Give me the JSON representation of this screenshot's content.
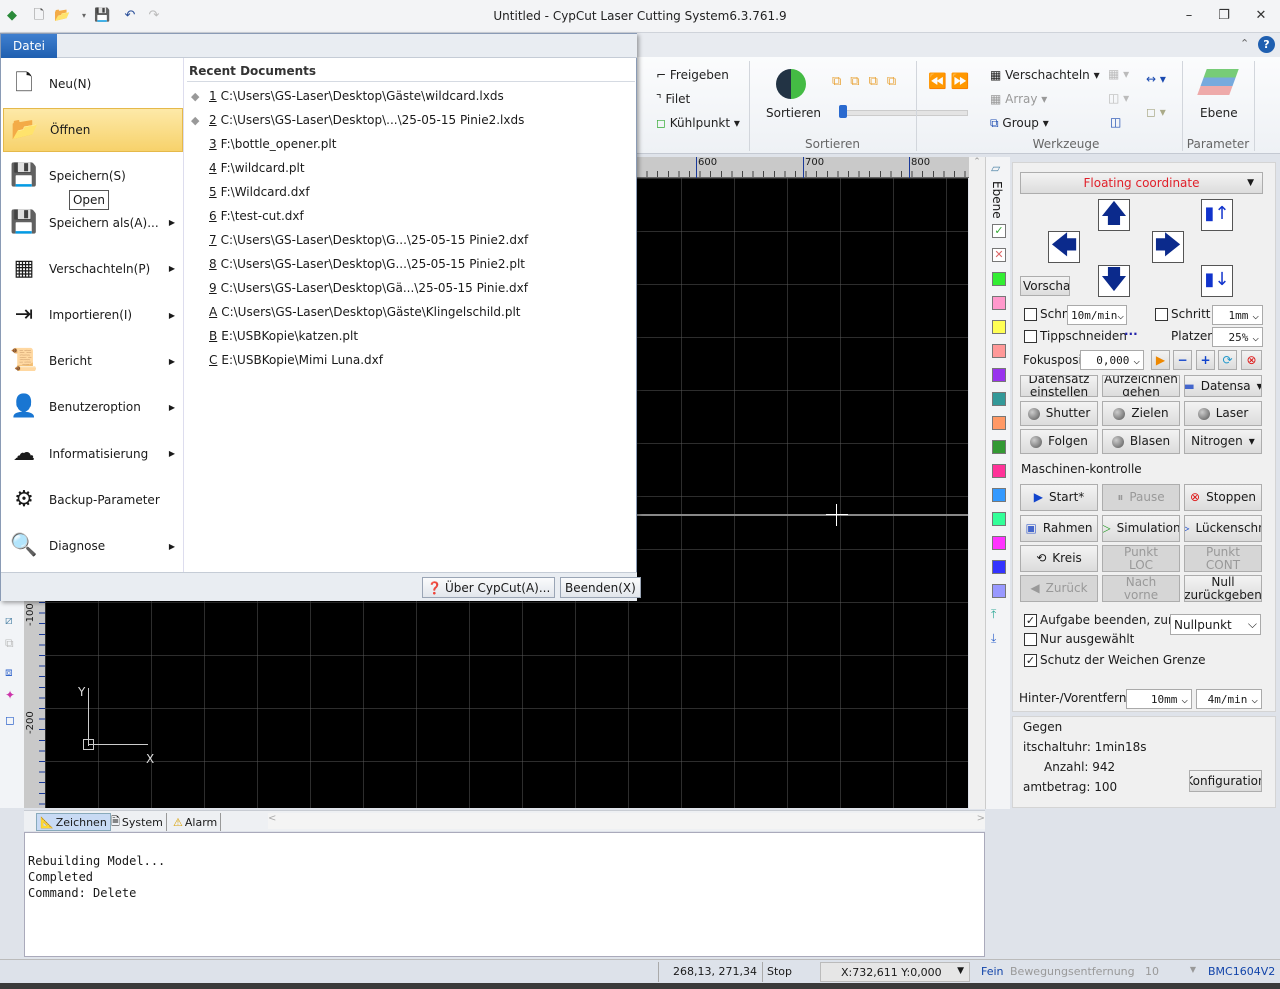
{
  "window": {
    "title": "Untitled - CypCut Laser Cutting System6.3.761.9"
  },
  "quick_access": {
    "icons": [
      "app-logo-icon",
      "new-file-icon",
      "open-folder-icon",
      "dropdown-icon",
      "save-icon",
      "undo-icon",
      "redo-icon"
    ]
  },
  "file_menu": {
    "tab_label": "Datei",
    "items": [
      {
        "label": "Neu(N)",
        "icon": "new-file-icon",
        "submenu": false
      },
      {
        "label": "Öffnen",
        "icon": "open-folder-icon",
        "submenu": false,
        "highlighted": true
      },
      {
        "label": "Speichern(S)",
        "icon": "save-icon",
        "submenu": false
      },
      {
        "label": "Speichern als(A)...",
        "icon": "save-as-icon",
        "submenu": true
      },
      {
        "label": "Verschachteln(P)",
        "icon": "nesting-icon",
        "submenu": true
      },
      {
        "label": "Importieren(I)",
        "icon": "import-icon",
        "submenu": true
      },
      {
        "label": "Bericht",
        "icon": "report-icon",
        "submenu": true
      },
      {
        "label": "Benutzeroption",
        "icon": "user-option-icon",
        "submenu": true
      },
      {
        "label": "Informatisierung",
        "icon": "cloud-icon",
        "submenu": true
      },
      {
        "label": "Backup-Parameter",
        "icon": "backup-icon",
        "submenu": false
      },
      {
        "label": "Diagnose",
        "icon": "diagnose-icon",
        "submenu": true
      }
    ],
    "tooltip": "Open",
    "recent_title": "Recent Documents",
    "recent": [
      {
        "key": "1",
        "path": "C:\\Users\\GS-Laser\\Desktop\\Gäste\\wildcard.lxds",
        "pinned": true
      },
      {
        "key": "2",
        "path": "C:\\Users\\GS-Laser\\Desktop\\...\\25-05-15 Pinie2.lxds",
        "pinned": true
      },
      {
        "key": "3",
        "path": "F:\\bottle_opener.plt"
      },
      {
        "key": "4",
        "path": "F:\\wildcard.plt"
      },
      {
        "key": "5",
        "path": "F:\\Wildcard.dxf"
      },
      {
        "key": "6",
        "path": "F:\\test-cut.dxf"
      },
      {
        "key": "7",
        "path": "C:\\Users\\GS-Laser\\Desktop\\G...\\25-05-15 Pinie2.dxf"
      },
      {
        "key": "8",
        "path": "C:\\Users\\GS-Laser\\Desktop\\G...\\25-05-15 Pinie2.plt"
      },
      {
        "key": "9",
        "path": "C:\\Users\\GS-Laser\\Desktop\\Gä...\\25-05-15 Pinie.dxf"
      },
      {
        "key": "A",
        "path": "C:\\Users\\GS-Laser\\Desktop\\Gäste\\Klingelschild.plt"
      },
      {
        "key": "B",
        "path": "E:\\USBKopie\\katzen.plt"
      },
      {
        "key": "C",
        "path": "E:\\USBKopie\\Mimi Luna.dxf"
      }
    ],
    "about_label": "Über CypCut(A)...",
    "exit_label": "Beenden(X)"
  },
  "ribbon": {
    "freigeben": "Freigeben",
    "filet": "Filet",
    "kuehlpunkt": "Kühlpunkt",
    "sortieren": "Sortieren",
    "group_sortieren": "Sortieren",
    "verschachteln": "Verschachteln",
    "array": "Array",
    "group": "Group",
    "group_werkzeuge": "Werkzeuge",
    "ebene": "Ebene",
    "group_parameter": "Parameter"
  },
  "ruler": {
    "top_ticks": [
      "600",
      "700",
      "800"
    ],
    "left_ticks": [
      "-100",
      "-200"
    ]
  },
  "canvas": {
    "axis_x": "X",
    "axis_y": "Y"
  },
  "bottom_tabs": [
    "Zeichnen",
    "System",
    "Alarm"
  ],
  "command_log": [
    "Rebuilding Model...",
    "Completed",
    "Command: Delete"
  ],
  "layers": {
    "title": "Ebene",
    "colors": [
      "#33ee33",
      "#ff99cc",
      "#ffff55",
      "#ff9999",
      "#9933ee",
      "#339999",
      "#ff9966",
      "#339933",
      "#ff3399",
      "#3399ff",
      "#33ff99",
      "#ff33ff",
      "#3333ff",
      "#9999ff"
    ]
  },
  "control": {
    "mode": "Floating coordinate",
    "mode_color": "#e0202a",
    "vorschau": "Vorschau",
    "schn_label": "Schn",
    "schn_value": "10m/min",
    "schritt_label": "Schritt",
    "schritt_value": "1mm",
    "tipp_label": "Tippschneiden",
    "tipp_more": "···",
    "platzen_label": "Platzen",
    "platzen_value": "25%",
    "fokus_label": "Fokusposit",
    "fokus_value": "0,000",
    "datensatz": "Datensatz einstellen",
    "aufzeichnen": "Aufzeichnen gehen",
    "datensatz2": "Datensa",
    "shutter": "Shutter",
    "zielen": "Zielen",
    "laser": "Laser",
    "folgen": "Folgen",
    "blasen": "Blasen",
    "nitrogen": "Nitrogen",
    "machine_title": "Maschinen-kontrolle",
    "start": "Start*",
    "pause": "Pause",
    "stoppen": "Stoppen",
    "rahmen": "Rahmen",
    "simulation": "Simulation",
    "lueckenschn": "Lückenschn",
    "kreis": "Kreis",
    "punkt_loc": "Punkt LOC",
    "punkt_cont": "Punkt CONT",
    "zurueck": "Zurück",
    "nach_vorne": "Nach vorne",
    "null": "Null zurückgeben",
    "aufgabe_label": "Aufgabe beenden, zurü",
    "aufgabe_checked": true,
    "aufgabe_value": "Nullpunkt",
    "nur_label": "Nur ausgewählt",
    "nur_checked": false,
    "schutz_label": "Schutz der Weichen Grenze",
    "schutz_checked": true,
    "hinter_label": "Hinter-/Vorentfernu",
    "hinter_value": "10mm",
    "hinter_speed": "4m/min"
  },
  "counter": {
    "title": "Gegen",
    "timer": "itschaltuhr: 1min18s",
    "anzahl": "Anzahl: 942",
    "betrag": "amtbetrag: 100",
    "config": "Konfiguration"
  },
  "status": {
    "coords": "268,13, 271,34",
    "state": "Stop",
    "pos": "X:732,611 Y:0,000",
    "fein": "Fein",
    "bewegung": "Bewegungsentfernung",
    "bewegung_value": "10",
    "card": "BMC1604V2"
  }
}
